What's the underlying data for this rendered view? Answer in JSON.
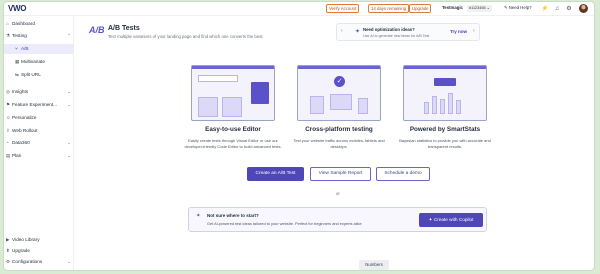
{
  "topbar": {
    "logo_text": "VWO",
    "verify_account": "Verify Account",
    "trial_remaining": "14 days remaining",
    "upgrade": "Upgrade",
    "account_name": "Testmagic",
    "account_id": "#1123456 ⌄",
    "need_help": "Need Help?"
  },
  "sidebar": {
    "items": [
      {
        "label": "Dashboard",
        "icon": "⌂"
      },
      {
        "label": "Testing",
        "icon": "⚗"
      },
      {
        "label": "A/B",
        "icon": "⑂"
      },
      {
        "label": "Multivariate",
        "icon": "▦"
      },
      {
        "label": "Split URL",
        "icon": "⇆"
      },
      {
        "label": "Insights",
        "icon": "◎"
      },
      {
        "label": "Feature Experiment...",
        "icon": "⚑"
      },
      {
        "label": "Personalize",
        "icon": "☺"
      },
      {
        "label": "Web Rollout",
        "icon": "⇪"
      },
      {
        "label": "Data360",
        "icon": "◔"
      },
      {
        "label": "Plan",
        "icon": "▤"
      },
      {
        "label": "Video Library",
        "icon": "▶"
      },
      {
        "label": "Upgrade",
        "icon": "⬆"
      },
      {
        "label": "Configurations",
        "icon": "⚙"
      }
    ]
  },
  "header": {
    "title": "A/B Tests",
    "subtitle": "Test multiple variations of your landing page and find which one converts the best",
    "icon_text": "A/B"
  },
  "promo": {
    "title": "Need optimization ideas?",
    "subtitle": "Use AI to generate new ideas for A/B Test",
    "action": "Try now"
  },
  "cards": [
    {
      "title": "Easy-to-use Editor",
      "desc": "Easily create tests through Visual Editor or use our developer-friendly Code Editor to build advanced tests."
    },
    {
      "title": "Cross-platform testing",
      "desc": "Test your website traffic across mobiles, tablets and desktops."
    },
    {
      "title": "Powered by SmartStats",
      "desc": "Bayesian statistics to provide you with accurate and transparent results."
    }
  ],
  "actions": {
    "create": "Create an A/B Test",
    "sample": "View Sample Report",
    "demo": "Schedule a demo",
    "or": "or"
  },
  "copilot": {
    "title": "Not sure where to start?",
    "subtitle": "Get AI-powered test ideas tailored to your website. Perfect for beginners and experts alike",
    "button": "Create with Copilot"
  },
  "footer_tab": "Numbers",
  "colors": {
    "accent": "#4f46b8",
    "warning": "#e07b3a",
    "background": "#d7ecd2"
  }
}
